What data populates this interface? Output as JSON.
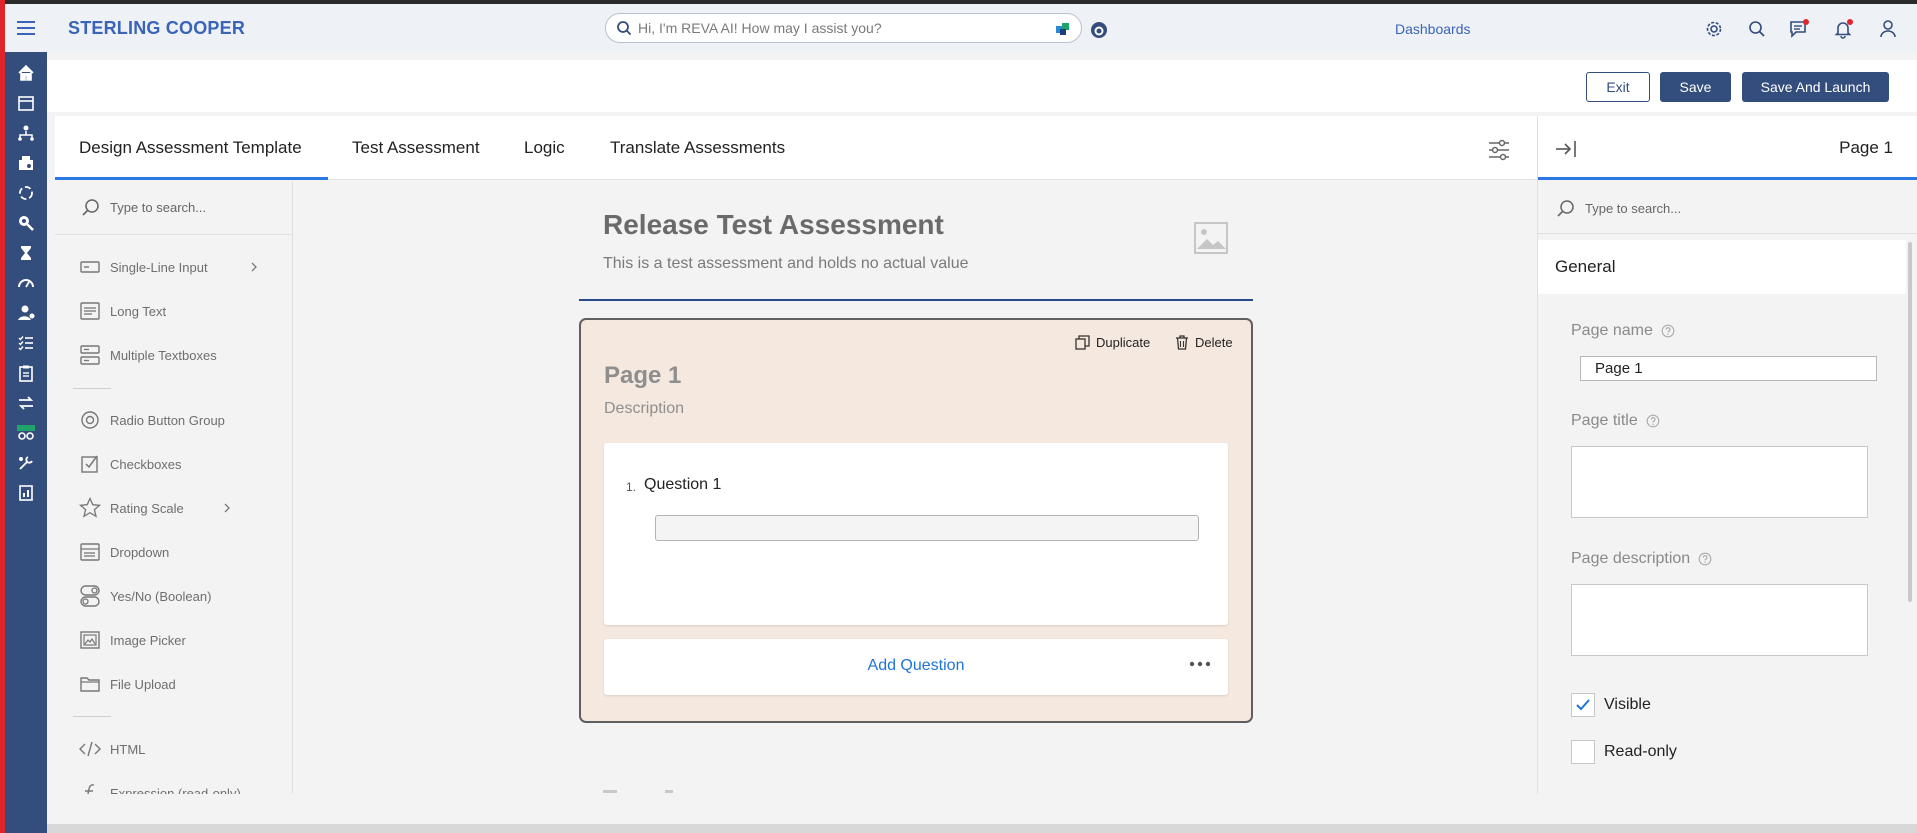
{
  "header": {
    "brand": "STERLING COOPER",
    "search_placeholder": "Hi, I'm REVA AI! How may I assist you?",
    "dashboards_label": "Dashboards"
  },
  "actions": {
    "exit_label": "Exit",
    "save_label": "Save",
    "save_launch_label": "Save And Launch"
  },
  "tabs": [
    {
      "label": "Design Assessment Template",
      "active": true
    },
    {
      "label": "Test Assessment"
    },
    {
      "label": "Logic"
    },
    {
      "label": "Translate Assessments"
    }
  ],
  "toolbox": {
    "search_placeholder": "Type to search...",
    "items": [
      {
        "label": "Single-Line Input",
        "icon": "single-line-input-icon",
        "submenu": true
      },
      {
        "label": "Long Text",
        "icon": "long-text-icon"
      },
      {
        "label": "Multiple Textboxes",
        "icon": "multiple-textboxes-icon"
      },
      {
        "label": "Radio Button Group",
        "icon": "radio-button-icon"
      },
      {
        "label": "Checkboxes",
        "icon": "checkbox-icon"
      },
      {
        "label": "Rating Scale",
        "icon": "star-icon",
        "submenu": true
      },
      {
        "label": "Dropdown",
        "icon": "dropdown-icon"
      },
      {
        "label": "Yes/No (Boolean)",
        "icon": "toggle-icon"
      },
      {
        "label": "Image Picker",
        "icon": "image-picker-icon"
      },
      {
        "label": "File Upload",
        "icon": "folder-icon"
      },
      {
        "label": "HTML",
        "icon": "code-icon"
      },
      {
        "label": "Expression (read-only)",
        "icon": "function-icon"
      }
    ]
  },
  "survey": {
    "title": "Release Test Assessment",
    "description": "This is a test assessment and holds no actual value",
    "page": {
      "name": "Page 1",
      "description": "Description",
      "duplicate_label": "Duplicate",
      "delete_label": "Delete",
      "question_number": "1.",
      "question_title": "Question 1",
      "add_question_label": "Add Question"
    }
  },
  "property_grid": {
    "selected_label": "Page 1",
    "search_placeholder": "Type to search...",
    "category": "General",
    "page_name_label": "Page name",
    "page_name_value": "Page 1",
    "page_title_label": "Page title",
    "page_description_label": "Page description",
    "visible_label": "Visible",
    "visible_checked": true,
    "readonly_label": "Read-only",
    "readonly_checked": false
  },
  "colors": {
    "rail": "#334d7c",
    "brand": "#3a64b8",
    "accent": "#2b78e4",
    "page_card_bg": "#f5e8de",
    "add_question": "#1f74d8",
    "notification_dot": "#e0242b"
  }
}
